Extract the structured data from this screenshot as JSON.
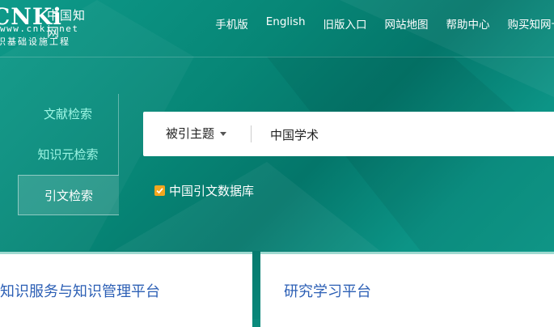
{
  "logo": {
    "brand": "CNKi",
    "cn_name": "中国知网",
    "url": "www.cnki.net",
    "subtitle": "识基础设施工程"
  },
  "nav": [
    "手机版",
    "English",
    "旧版入口",
    "网站地图",
    "帮助中心",
    "购买知网卡"
  ],
  "search_tabs": [
    {
      "label": "文献检索",
      "active": false
    },
    {
      "label": "知识元检索",
      "active": false
    },
    {
      "label": "引文检索",
      "active": true
    }
  ],
  "search": {
    "field": "被引主题",
    "value": "中国学术"
  },
  "database_checkbox": {
    "label": "中国引文数据库",
    "checked": true,
    "color": "#f2a61f"
  },
  "cards": [
    {
      "title": "业知识服务与知识管理平台"
    },
    {
      "title": "研究学习平台"
    }
  ],
  "colors": {
    "primary": "#0a8a7c",
    "link": "#2c5fb5",
    "tab_text": "#9cf6e4"
  }
}
